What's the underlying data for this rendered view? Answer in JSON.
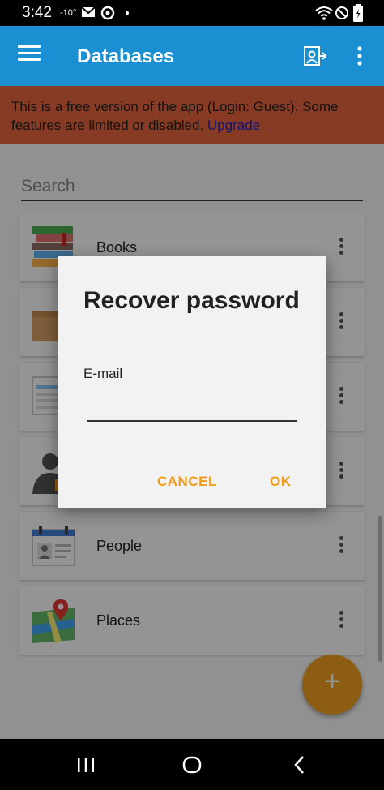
{
  "status_bar": {
    "time": "3:42",
    "temperature": "-10°",
    "icons": [
      "gmail-icon",
      "sync-icon",
      "wifi-icon",
      "do-not-disturb-icon",
      "battery-icon"
    ]
  },
  "app_bar": {
    "title": "Databases",
    "icons": [
      "hamburger-menu-icon",
      "login-icon",
      "more-vert-icon"
    ],
    "color": "#1a8fd1"
  },
  "banner": {
    "text": "This is a free version of the app (Login: Guest). Some features are limited or disabled.",
    "link": "Upgrade",
    "color": "#e8653f"
  },
  "search": {
    "placeholder": "Search"
  },
  "databases": [
    {
      "label": "Books",
      "icon": "books-icon"
    },
    {
      "label": "",
      "icon": "box-icon"
    },
    {
      "label": "",
      "icon": "table-icon"
    },
    {
      "label": "",
      "icon": "person-silhouette-icon"
    },
    {
      "label": "People",
      "icon": "contact-card-icon"
    },
    {
      "label": "Places",
      "icon": "map-pin-icon"
    }
  ],
  "fab": {
    "label": "+",
    "color": "#f2a021"
  },
  "dialog": {
    "title": "Recover password",
    "field_label": "E-mail",
    "field_value": "",
    "cancel_label": "CANCEL",
    "ok_label": "OK",
    "accent": "#f29a1a"
  },
  "nav_bar": {
    "icons": [
      "recents-icon",
      "home-icon",
      "back-icon"
    ]
  }
}
